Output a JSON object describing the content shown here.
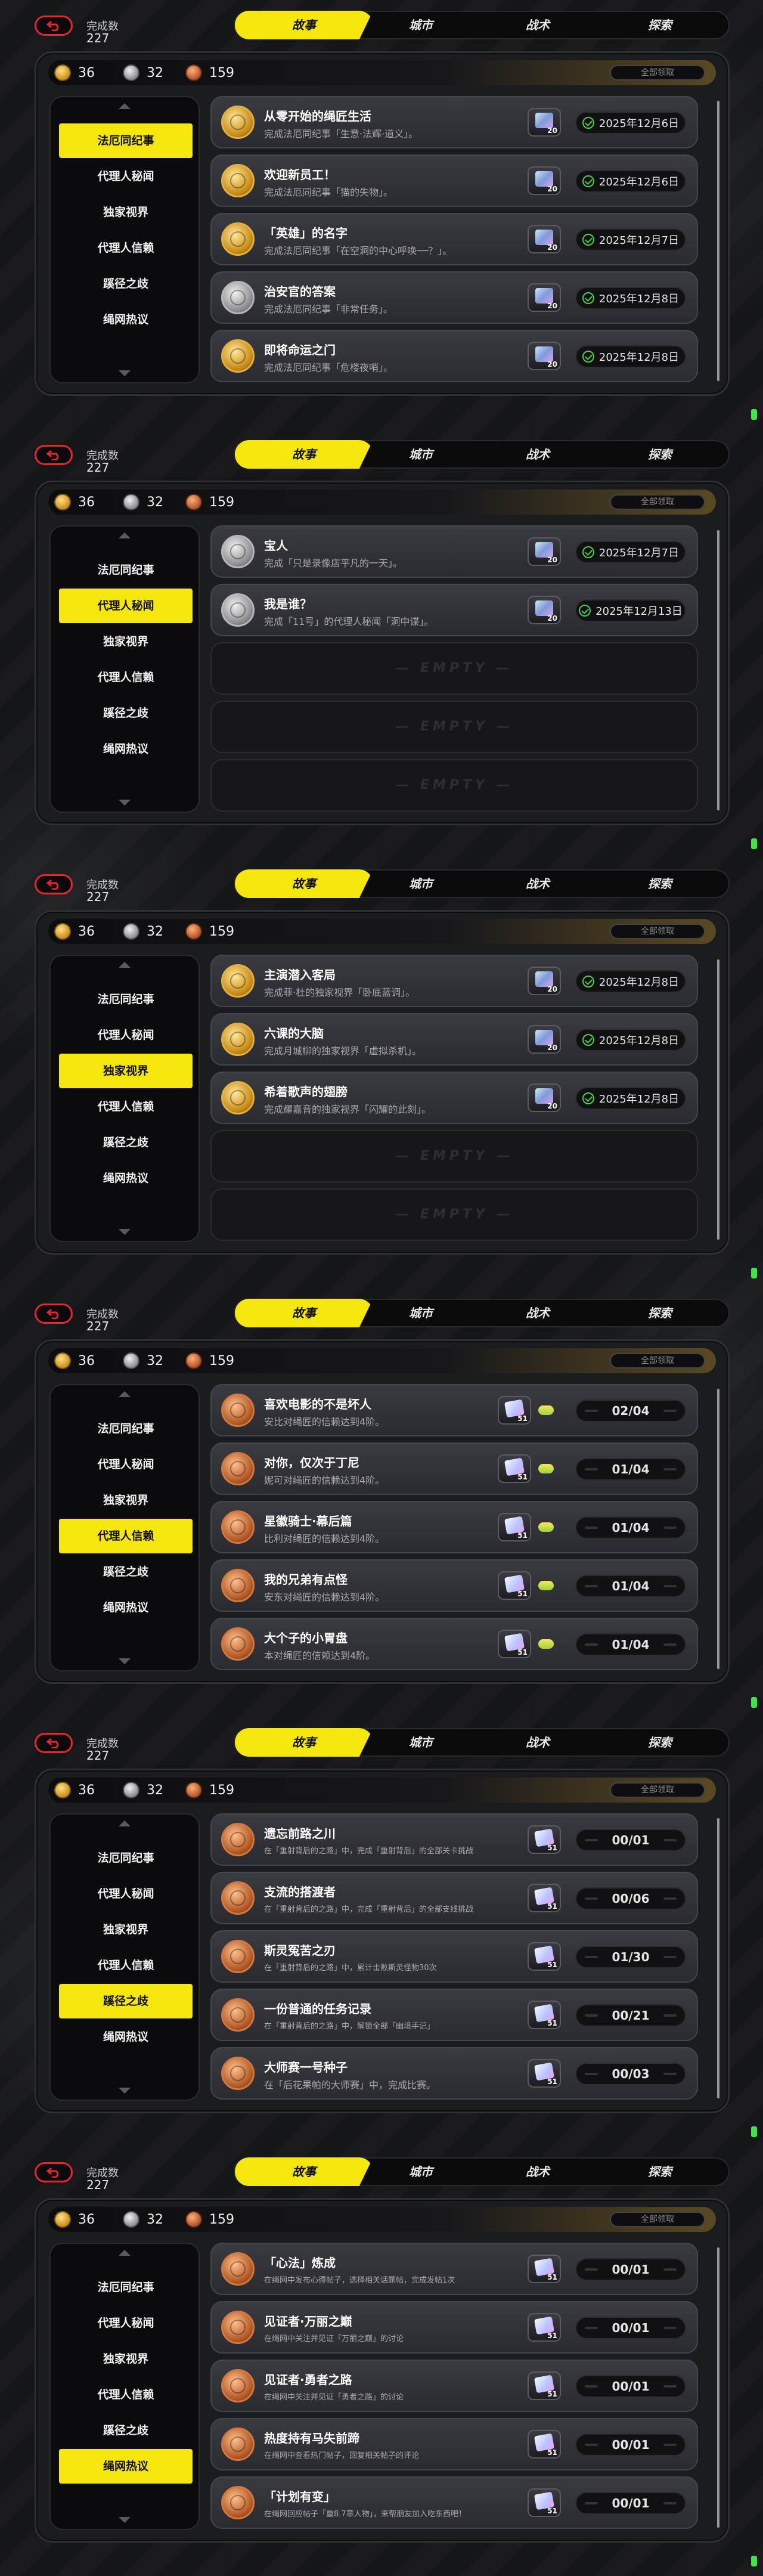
{
  "header": {
    "count_label": "完成数",
    "count_value": "227",
    "tabs": [
      "故事",
      "城市",
      "战术",
      "探索"
    ]
  },
  "currency": {
    "gold": "36",
    "silver": "32",
    "bronze": "159",
    "claim_all": "全部领取"
  },
  "sidebar": [
    "法厄同纪事",
    "代理人秘闻",
    "独家视界",
    "代理人信赖",
    "蹊径之歧",
    "绳网热议"
  ],
  "empty_label": "— EMPTY —",
  "screens": [
    {
      "active": 0,
      "rows": [
        {
          "medal": "gold",
          "title": "从零开始的绳匠生活",
          "desc": "完成法厄同纪事「生意·法辉·道义」。",
          "reward": "film",
          "qty": "20",
          "status": "2025年12月6日"
        },
        {
          "medal": "gold",
          "title": "欢迎新员工！",
          "desc": "完成法厄同纪事「猫的失物」。",
          "reward": "film",
          "qty": "20",
          "status": "2025年12月6日"
        },
        {
          "medal": "gold",
          "title": "「英雄」的名字",
          "desc": "完成法厄同纪事「在空洞的中心呼唤──？」。",
          "reward": "film",
          "qty": "20",
          "status": "2025年12月7日"
        },
        {
          "medal": "silver",
          "title": "治安官的答案",
          "desc": "完成法厄同纪事「非常任务」。",
          "reward": "film",
          "qty": "20",
          "status": "2025年12月8日"
        },
        {
          "medal": "gold",
          "title": "即将命运之门",
          "desc": "完成法厄同纪事「危楼夜哨」。",
          "reward": "film",
          "qty": "20",
          "status": "2025年12月8日"
        }
      ]
    },
    {
      "active": 1,
      "rows": [
        {
          "medal": "silver",
          "title": "宝人",
          "desc": "完成「只是录像店平凡的一天」。",
          "reward": "film",
          "qty": "20",
          "status": "2025年12月7日"
        },
        {
          "medal": "silver",
          "title": "我是谁？",
          "desc": "完成「11号」的代理人秘闻「洞中谍」。",
          "reward": "film",
          "qty": "20",
          "status": "2025年12月13日"
        }
      ],
      "empties": 3
    },
    {
      "active": 2,
      "rows": [
        {
          "medal": "gold",
          "title": "主演潜入客局",
          "desc": "完成菲·杜的独家视界「卧底蓝调」。",
          "reward": "film",
          "qty": "20",
          "status": "2025年12月8日"
        },
        {
          "medal": "gold",
          "title": "六课的大脑",
          "desc": "完成月城柳的独家视界「虚拟杀机」。",
          "reward": "film",
          "qty": "20",
          "status": "2025年12月8日"
        },
        {
          "medal": "gold",
          "title": "希着歌声的翅膀",
          "desc": "完成耀嘉音的独家视界「闪耀的此刻」。",
          "reward": "film",
          "qty": "20",
          "status": "2025年12月8日"
        }
      ],
      "empties": 2
    },
    {
      "active": 3,
      "rows": [
        {
          "medal": "bronze",
          "title": "喜欢电影的不是坏人",
          "desc": "安比对绳匠的信赖达到4阶。",
          "reward": "ticket",
          "qty": "51",
          "extra": true,
          "status": "02/04"
        },
        {
          "medal": "bronze",
          "title": "对你，仅次于丁尼",
          "desc": "妮可对绳匠的信赖达到4阶。",
          "reward": "ticket",
          "qty": "51",
          "extra": true,
          "status": "01/04"
        },
        {
          "medal": "bronze",
          "title": "星徽骑士·幕后篇",
          "desc": "比利对绳匠的信赖达到4阶。",
          "reward": "ticket",
          "qty": "51",
          "extra": true,
          "status": "01/04"
        },
        {
          "medal": "bronze",
          "title": "我的兄弟有点怪",
          "desc": "安东对绳匠的信赖达到4阶。",
          "reward": "ticket",
          "qty": "51",
          "extra": true,
          "status": "01/04"
        },
        {
          "medal": "bronze",
          "title": "大个子的小胃盘",
          "desc": "本对绳匠的信赖达到4阶。",
          "reward": "ticket",
          "qty": "51",
          "extra": true,
          "status": "01/04"
        }
      ]
    },
    {
      "active": 4,
      "rows": [
        {
          "medal": "bronze",
          "title": "遗忘前路之川",
          "desc": "在「重射背后的之路」中，完成「重射背后」的全部关卡挑战",
          "small": true,
          "reward": "ticket",
          "qty": "51",
          "status": "00/01"
        },
        {
          "medal": "bronze",
          "title": "支流的搭渡者",
          "desc": "在「重射背后的之路」中，完成「重射背后」的全部支线挑战",
          "small": true,
          "reward": "ticket",
          "qty": "51",
          "status": "00/06"
        },
        {
          "medal": "bronze",
          "title": "斯灵冤苦之刃",
          "desc": "在「重射背后的之路」中，累计击败斯灵怪物30次",
          "small": true,
          "reward": "ticket",
          "qty": "51",
          "status": "01/30"
        },
        {
          "medal": "bronze",
          "title": "一份普通的任务记录",
          "desc": "在「重射背后的之路」中，解锁全部「幽境手记」",
          "small": true,
          "reward": "ticket",
          "qty": "51",
          "status": "00/21"
        },
        {
          "medal": "bronze",
          "title": "大师赛一号种子",
          "desc": "在「后花果帕的大师赛」中，完成比赛。",
          "reward": "ticket",
          "qty": "51",
          "status": "00/03"
        }
      ]
    },
    {
      "active": 5,
      "rows": [
        {
          "medal": "bronze",
          "title": "「心法」炼成",
          "desc": "在绳网中发布心得帖子，选择相关话题帖，完成发帖1次",
          "small": true,
          "reward": "ticket",
          "qty": "51",
          "status": "00/01"
        },
        {
          "medal": "bronze",
          "title": "见证者·万丽之巅",
          "desc": "在绳网中关注并见证「万丽之巅」的讨论",
          "small": true,
          "reward": "ticket",
          "qty": "51",
          "status": "00/01"
        },
        {
          "medal": "bronze",
          "title": "见证者·勇者之路",
          "desc": "在绳网中关注并见证「勇者之路」的讨论",
          "small": true,
          "reward": "ticket",
          "qty": "51",
          "status": "00/01"
        },
        {
          "medal": "bronze",
          "title": "热度持有马失前蹄",
          "desc": "在绳网中查看热门帖子，回复相关帖子的评论",
          "small": true,
          "reward": "ticket",
          "qty": "51",
          "status": "00/01"
        },
        {
          "medal": "bronze",
          "title": "「计划有变」",
          "desc": "在绳网回应帖子「重8.7章人物」，来帮朋友加入吃东西吧！",
          "small": true,
          "reward": "ticket",
          "qty": "51",
          "status": "00/01"
        }
      ]
    }
  ]
}
